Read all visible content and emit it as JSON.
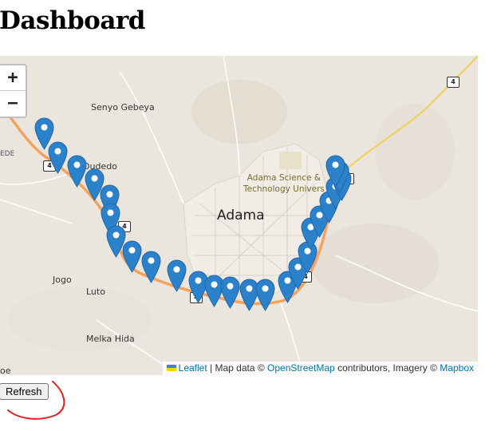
{
  "page": {
    "title": "Dashboard"
  },
  "map": {
    "zoom_in": "+",
    "zoom_out": "−",
    "places": {
      "senyo": "Senyo Gebeya",
      "dudedo": "Dudedo",
      "ede": "EDE",
      "jogo": "Jogo",
      "luto": "Luto",
      "melka": "Melka Hida",
      "oe": "oe"
    },
    "city": "Adama",
    "university_line1": "Adama Science &",
    "university_line2": "Technology Univers",
    "road_number": "4",
    "marker_count": 26,
    "attribution": {
      "leaflet": "Leaflet",
      "sep": " | Map data © ",
      "osm": "OpenStreetMap",
      "contrib": " contributors, Imagery © ",
      "mapbox": "Mapbox"
    },
    "colors": {
      "route": "#f5a35c",
      "marker": "#2b82cb",
      "highway": "#f2d060"
    }
  },
  "actions": {
    "refresh_label": "Refresh"
  }
}
